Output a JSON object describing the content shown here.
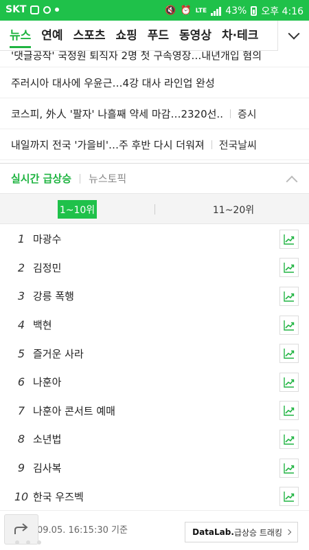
{
  "status_bar": {
    "carrier": "SKT",
    "network": "LTE",
    "battery": "43%",
    "time": "오후 4:16",
    "icons": [
      "download-icon",
      "refresh-icon",
      "circle-icon",
      "mute-icon",
      "alarm-icon",
      "signal-icon",
      "battery-icon"
    ]
  },
  "top_nav": {
    "tabs": [
      "뉴스",
      "연예",
      "스포츠",
      "쇼핑",
      "푸드",
      "동영상",
      "차·테크"
    ],
    "active_tab": "뉴스",
    "more_icon": "chevron-down-icon"
  },
  "headlines": [
    {
      "title": "'댓글공작' 국정원 퇴직자 2명 첫 구속영장…내년개입 혐의",
      "category": ""
    },
    {
      "title": "주러시아 대사에 우윤근…4강 대사 라인업 완성",
      "category": ""
    },
    {
      "title": "코스피, 外人 '팔자' 나흘째 약세 마감…2320선..",
      "category": "증시"
    },
    {
      "title": "내일까지 전국 '가을비'…주 후반 다시 더워져",
      "category": "전국날씨"
    }
  ],
  "realtime": {
    "tab_active": "실시간 급상승",
    "tab_inactive": "뉴스토픽",
    "collapse_icon": "chevron-up-icon",
    "range_tabs": [
      "1~10위",
      "11~20위"
    ],
    "active_range": "1~10위",
    "rankings": [
      {
        "rank": "1",
        "keyword": "마광수"
      },
      {
        "rank": "2",
        "keyword": "김정민"
      },
      {
        "rank": "3",
        "keyword": "강릉 폭행"
      },
      {
        "rank": "4",
        "keyword": "백현"
      },
      {
        "rank": "5",
        "keyword": "즐거운 사라"
      },
      {
        "rank": "6",
        "keyword": "나훈아"
      },
      {
        "rank": "7",
        "keyword": "나훈아 콘서트 예매"
      },
      {
        "rank": "8",
        "keyword": "소년법"
      },
      {
        "rank": "9",
        "keyword": "김사복"
      },
      {
        "rank": "10",
        "keyword": "한국 우즈벡"
      }
    ],
    "trend_icon": "trend-chart-icon"
  },
  "footer": {
    "timestamp": "09.05. 16:15:30 기준",
    "datalab_brand": "DataLab.",
    "datalab_label": "급상승 트래킹",
    "share_icon": "share-icon"
  },
  "colors": {
    "accent": "#1fb441",
    "status_bar": "#1fc14a"
  }
}
